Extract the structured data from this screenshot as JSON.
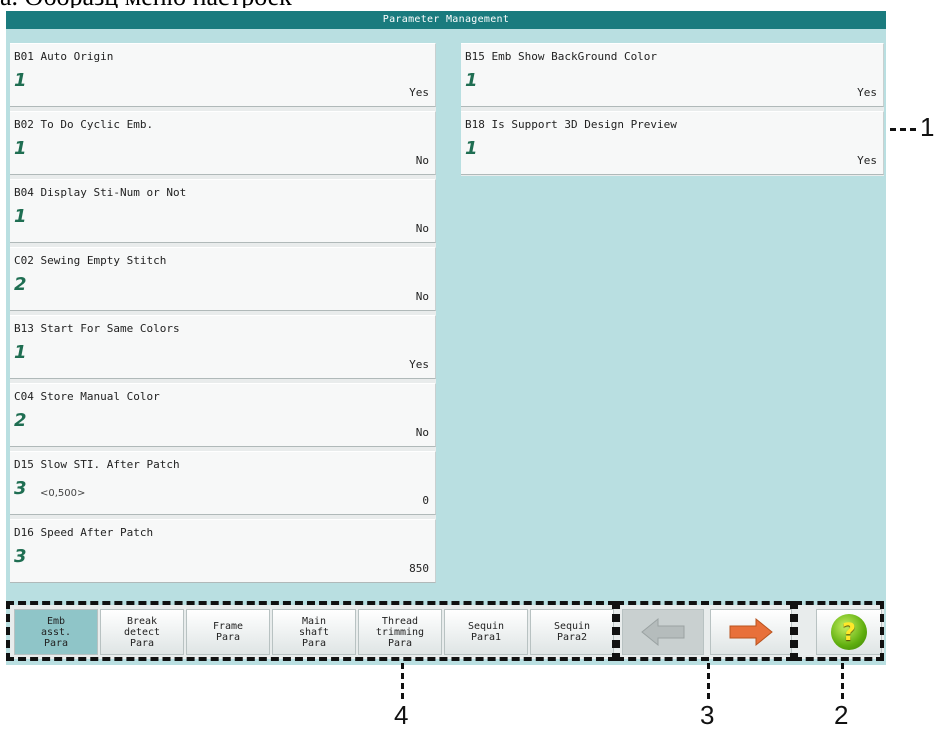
{
  "header_caption": "а. Оборазц меню настроек",
  "window": {
    "title": "Parameter Management"
  },
  "left_params": [
    {
      "name": "B01 Auto Origin",
      "level": "1",
      "range": "",
      "value": "Yes"
    },
    {
      "name": "B02 To Do Cyclic Emb.",
      "level": "1",
      "range": "",
      "value": "No"
    },
    {
      "name": "B04 Display Sti-Num or Not",
      "level": "1",
      "range": "",
      "value": "No"
    },
    {
      "name": "C02 Sewing Empty Stitch",
      "level": "2",
      "range": "",
      "value": "No"
    },
    {
      "name": "B13 Start For Same Colors",
      "level": "1",
      "range": "",
      "value": "Yes"
    },
    {
      "name": "C04 Store Manual Color",
      "level": "2",
      "range": "",
      "value": "No"
    },
    {
      "name": "D15 Slow STI. After Patch",
      "level": "3",
      "range": "<0,500>",
      "value": "0"
    },
    {
      "name": "D16 Speed After Patch",
      "level": "3",
      "range": "",
      "value": "850"
    }
  ],
  "right_params": [
    {
      "name": "B15 Emb Show BackGround Color",
      "level": "1",
      "value": "Yes"
    },
    {
      "name": "B18 Is Support 3D Design Preview",
      "level": "1",
      "value": "Yes"
    }
  ],
  "tabs": [
    {
      "label": "Emb\nasst.\nPara",
      "active": true
    },
    {
      "label": "Break\ndetect\nPara",
      "active": false
    },
    {
      "label": "Frame\nPara",
      "active": false
    },
    {
      "label": "Main\nshaft\nPara",
      "active": false
    },
    {
      "label": "Thread\ntrimming\nPara",
      "active": false
    },
    {
      "label": "Sequin\nPara1",
      "active": false
    },
    {
      "label": "Sequin\nPara2",
      "active": false
    }
  ],
  "nav": {
    "prev_icon": "arrow-left-icon",
    "next_icon": "arrow-right-icon",
    "prev_disabled": true
  },
  "help": {
    "glyph": "?",
    "icon": "help-icon"
  },
  "callouts": {
    "c1": "1",
    "c2": "2",
    "c3": "3",
    "c4": "4"
  },
  "colors": {
    "title_bar": "#1a7b7e",
    "screen_bg": "#b9dfe1",
    "level_text": "#1f6e52",
    "active_tab": "#8fc5c8",
    "arrow": "#e8703a"
  }
}
